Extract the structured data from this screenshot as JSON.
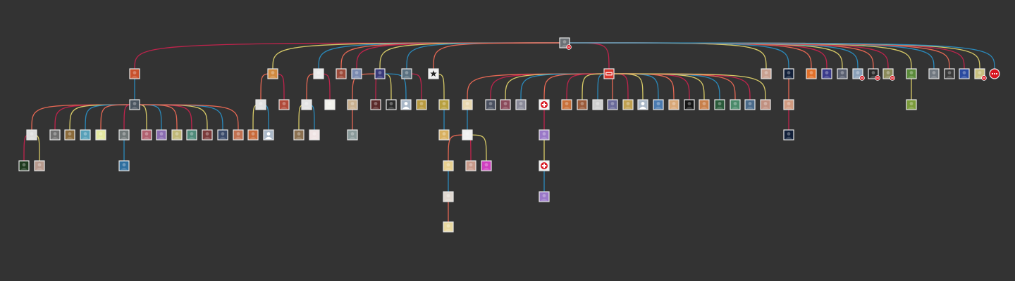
{
  "tree": {
    "root": {
      "id": "root",
      "icon": "user-avatar",
      "color": "#6b7075",
      "badge": "minus-badge"
    },
    "link_colors": [
      "#c8234e",
      "#e0d36a",
      "#2a8fc4",
      "#ee6a55"
    ],
    "badge_color": "#d8151f",
    "more_button": {
      "icon": "ellipsis-icon",
      "color": "#d8151f"
    },
    "children": [
      {
        "id": "n1",
        "icon": "user-avatar",
        "color": "#c8502b",
        "children": [
          {
            "id": "n1a",
            "icon": "user-avatar",
            "color": "#4a5560",
            "children": [
              {
                "id": "n1a1",
                "icon": "user-avatar",
                "color": "#dcdcdc",
                "children": [
                  {
                    "id": "n1a1a",
                    "icon": "user-avatar",
                    "color": "#1f3a1f"
                  },
                  {
                    "id": "n1a1b",
                    "icon": "user-avatar",
                    "color": "#b79a8d"
                  }
                ]
              },
              {
                "id": "n1a2",
                "icon": "user-avatar",
                "color": "#6f6f6f"
              },
              {
                "id": "n1a3",
                "icon": "user-avatar",
                "color": "#8a6a3a"
              },
              {
                "id": "n1a4",
                "icon": "user-avatar",
                "color": "#58a0b8"
              },
              {
                "id": "n1a5",
                "icon": "user-avatar",
                "color": "#e4e8a0"
              },
              {
                "id": "n1a6",
                "icon": "user-avatar",
                "color": "#707878",
                "children": [
                  {
                    "id": "n1a6a",
                    "icon": "user-avatar",
                    "color": "#2f6f9f"
                  }
                ]
              },
              {
                "id": "n1a7",
                "icon": "user-avatar",
                "color": "#b0606f"
              },
              {
                "id": "n1a8",
                "icon": "user-avatar",
                "color": "#8a6cb0"
              },
              {
                "id": "n1a9",
                "icon": "user-avatar",
                "color": "#c0b878"
              },
              {
                "id": "n1a10",
                "icon": "user-avatar",
                "color": "#4f8a7a"
              },
              {
                "id": "n1a11",
                "icon": "user-avatar",
                "color": "#7a3a3a"
              },
              {
                "id": "n1a12",
                "icon": "user-avatar",
                "color": "#3a4a6a"
              },
              {
                "id": "n1a13",
                "icon": "user-avatar",
                "color": "#c07050"
              }
            ]
          }
        ]
      },
      {
        "id": "n2",
        "icon": "user-avatar",
        "color": "#d08a40",
        "children": [
          {
            "id": "n2a",
            "icon": "user-avatar",
            "color": "#e0e0e0",
            "children": [
              {
                "id": "n2a1",
                "icon": "user-avatar",
                "color": "#c86a3a"
              },
              {
                "id": "n2a2",
                "icon": "default-avatar",
                "color": "#aab8c8"
              }
            ]
          },
          {
            "id": "n2b",
            "icon": "user-avatar",
            "color": "#b04a3a"
          }
        ]
      },
      {
        "id": "n3",
        "icon": "user-avatar",
        "color": "#eaeaea",
        "children": [
          {
            "id": "n3a",
            "icon": "user-avatar",
            "color": "#e4e4e4",
            "children": [
              {
                "id": "n3a1",
                "icon": "user-avatar",
                "color": "#8a7050"
              },
              {
                "id": "n3a2",
                "icon": "user-avatar",
                "color": "#f0e4e4"
              }
            ]
          },
          {
            "id": "n3b",
            "icon": "user-avatar",
            "color": "#f2f2ec"
          }
        ]
      },
      {
        "id": "n4",
        "icon": "user-avatar",
        "color": "#9a4a3a"
      },
      {
        "id": "n5",
        "icon": "user-avatar",
        "color": "#7a8ab0"
      },
      {
        "id": "n6",
        "icon": "user-avatar",
        "color": "#3a3a7a",
        "children": [
          {
            "id": "n6a",
            "icon": "user-avatar",
            "color": "#c8b090",
            "children": [
              {
                "id": "n6a1",
                "icon": "user-avatar",
                "color": "#8a9a9a"
              }
            ]
          },
          {
            "id": "n6b",
            "icon": "user-avatar",
            "color": "#5a2a2a"
          },
          {
            "id": "n6c",
            "icon": "user-avatar",
            "color": "#2a2a2a"
          },
          {
            "id": "n6d",
            "icon": "default-avatar",
            "color": "#aab8c8"
          }
        ]
      },
      {
        "id": "n7",
        "icon": "user-avatar",
        "color": "#5a7080",
        "children": [
          {
            "id": "n7a",
            "icon": "user-avatar",
            "color": "#b89a40"
          }
        ]
      },
      {
        "id": "n8",
        "icon": "star-avatar",
        "color": "#f0f0f0",
        "children": [
          {
            "id": "n8a",
            "icon": "user-avatar",
            "color": "#b8a040",
            "children": [
              {
                "id": "n8a1",
                "icon": "user-avatar",
                "color": "#d8b060"
              }
            ]
          }
        ]
      },
      {
        "id": "n9",
        "icon": "brand-logo",
        "color": "#d8342a",
        "children": [
          {
            "id": "n9a",
            "icon": "user-avatar",
            "color": "#e8d8b0",
            "children": [
              {
                "id": "n9a1",
                "icon": "user-avatar",
                "color": "#f0f0f0",
                "children": [
                  {
                    "id": "n9a1a",
                    "icon": "user-avatar",
                    "color": "#e8d090",
                    "children": [
                      {
                        "id": "n9a1a1",
                        "icon": "user-avatar",
                        "color": "#e0d8d0",
                        "children": [
                          {
                            "id": "n9a1a1a",
                            "icon": "user-avatar",
                            "color": "#e8d8a0"
                          }
                        ]
                      }
                    ]
                  },
                  {
                    "id": "n9a1b",
                    "icon": "user-avatar",
                    "color": "#c89a8a"
                  },
                  {
                    "id": "n9a1c",
                    "icon": "user-avatar",
                    "color": "#d040c0"
                  }
                ]
              }
            ]
          },
          {
            "id": "n9b",
            "icon": "user-avatar",
            "color": "#4a5060"
          },
          {
            "id": "n9c",
            "icon": "user-avatar",
            "color": "#8a4a5a"
          },
          {
            "id": "n9d",
            "icon": "user-avatar",
            "color": "#8a8a98"
          },
          {
            "id": "n9e",
            "icon": "medical-cross-icon",
            "color": "#f4f4f4",
            "children": [
              {
                "id": "n9e1",
                "icon": "user-avatar",
                "color": "#9a78c8",
                "children": [
                  {
                    "id": "n9e1a",
                    "icon": "medical-cross-icon",
                    "color": "#f4f4f4",
                    "children": [
                      {
                        "id": "n9e1a1",
                        "icon": "user-avatar",
                        "color": "#9a78c8"
                      }
                    ]
                  }
                ]
              }
            ]
          },
          {
            "id": "n9f",
            "icon": "user-avatar",
            "color": "#c8703a"
          },
          {
            "id": "n9g",
            "icon": "user-avatar",
            "color": "#9a5a3a"
          },
          {
            "id": "n9h",
            "icon": "user-avatar",
            "color": "#d0d0d0"
          },
          {
            "id": "n9i",
            "icon": "user-avatar",
            "color": "#6a6a9a"
          },
          {
            "id": "n9j",
            "icon": "user-avatar",
            "color": "#c0a050"
          },
          {
            "id": "n9k",
            "icon": "default-avatar",
            "color": "#aab8c8"
          },
          {
            "id": "n9l",
            "icon": "user-avatar",
            "color": "#4a7ab0"
          },
          {
            "id": "n9m",
            "icon": "user-avatar",
            "color": "#d8a878"
          },
          {
            "id": "n9n",
            "icon": "user-avatar",
            "color": "#151515"
          },
          {
            "id": "n9o",
            "icon": "user-avatar",
            "color": "#c8804a"
          },
          {
            "id": "n9p",
            "icon": "user-avatar",
            "color": "#2a5a3a"
          },
          {
            "id": "n9q",
            "icon": "user-avatar",
            "color": "#4a8a6a"
          },
          {
            "id": "n9r",
            "icon": "user-avatar",
            "color": "#4a6a8a"
          },
          {
            "id": "n9s",
            "icon": "user-avatar",
            "color": "#c09080"
          }
        ]
      },
      {
        "id": "n10",
        "icon": "user-avatar",
        "color": "#c8a090",
        "children": []
      },
      {
        "id": "n11",
        "icon": "user-avatar",
        "color": "#12203a",
        "children": [
          {
            "id": "n11a",
            "icon": "user-avatar",
            "color": "#d09a80",
            "children": [
              {
                "id": "n11a1",
                "icon": "user-avatar",
                "color": "#12203a"
              }
            ]
          }
        ]
      },
      {
        "id": "n12",
        "icon": "user-avatar",
        "color": "#e0702a"
      },
      {
        "id": "n13",
        "icon": "user-avatar",
        "color": "#3a3a8a"
      },
      {
        "id": "n14",
        "icon": "user-avatar",
        "color": "#5a6070"
      },
      {
        "id": "n15",
        "icon": "user-avatar",
        "color": "#8aa0b8",
        "badge": "minus-badge"
      },
      {
        "id": "n16",
        "icon": "user-avatar",
        "color": "#2a2a2a",
        "badge": "minus-badge"
      },
      {
        "id": "n17",
        "icon": "user-avatar",
        "color": "#8a8a5a",
        "badge": "minus-badge"
      },
      {
        "id": "n18",
        "icon": "user-avatar",
        "color": "#5a8a3a",
        "children": [
          {
            "id": "n18a",
            "icon": "user-avatar",
            "color": "#7a9a3a"
          }
        ]
      },
      {
        "id": "n19",
        "icon": "user-avatar",
        "color": "#707880"
      },
      {
        "id": "n20",
        "icon": "user-avatar",
        "color": "#3a3a3a"
      },
      {
        "id": "n21",
        "icon": "user-avatar",
        "color": "#2a4aa0"
      },
      {
        "id": "n22",
        "icon": "user-avatar",
        "color": "#c8c080",
        "badge": "minus-badge"
      }
    ]
  }
}
